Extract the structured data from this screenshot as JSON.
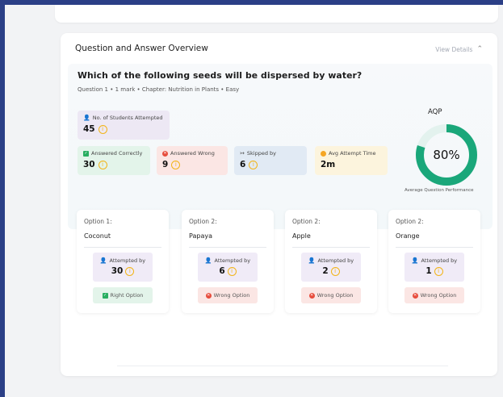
{
  "card": {
    "title": "Question and Answer Overview",
    "view_details": "View Details",
    "question": "Which of the following seeds will be dispersed by water?",
    "meta": "Question 1 • 1 mark • Chapter: Nutrition in Plants • Easy"
  },
  "stats": {
    "attempted": {
      "label": "No. of Students Attempted",
      "value": "45"
    },
    "correct": {
      "label": "Answered Correctly",
      "value": "30"
    },
    "wrong": {
      "label": "Answered Wrong",
      "value": "9"
    },
    "skipped": {
      "label": "Skipped by",
      "value": "6"
    },
    "avg_time": {
      "label": "Avg Attempt Time",
      "value": "2m"
    }
  },
  "aqp": {
    "title": "AQP",
    "value": "80%",
    "percent": 80,
    "subtitle": "Average Question Performance"
  },
  "options": [
    {
      "num": "Option 1:",
      "name": "Coconut",
      "att_label": "Attempted by",
      "att_value": "30",
      "tag": "Right Option"
    },
    {
      "num": "Option 2:",
      "name": "Papaya",
      "att_label": "Attempted by",
      "att_value": "6",
      "tag": "Wrong Option"
    },
    {
      "num": "Option 2:",
      "name": "Apple",
      "att_label": "Attempted by",
      "att_value": "2",
      "tag": "Wrong Option"
    },
    {
      "num": "Option 2:",
      "name": "Orange",
      "att_label": "Attempted by",
      "att_value": "1",
      "tag": "Wrong Option"
    }
  ],
  "colors": {
    "frame": "#2b3f86",
    "gauge": "#1aa77a",
    "gauge_track": "#e3f2ee",
    "info": "#f2b418"
  }
}
